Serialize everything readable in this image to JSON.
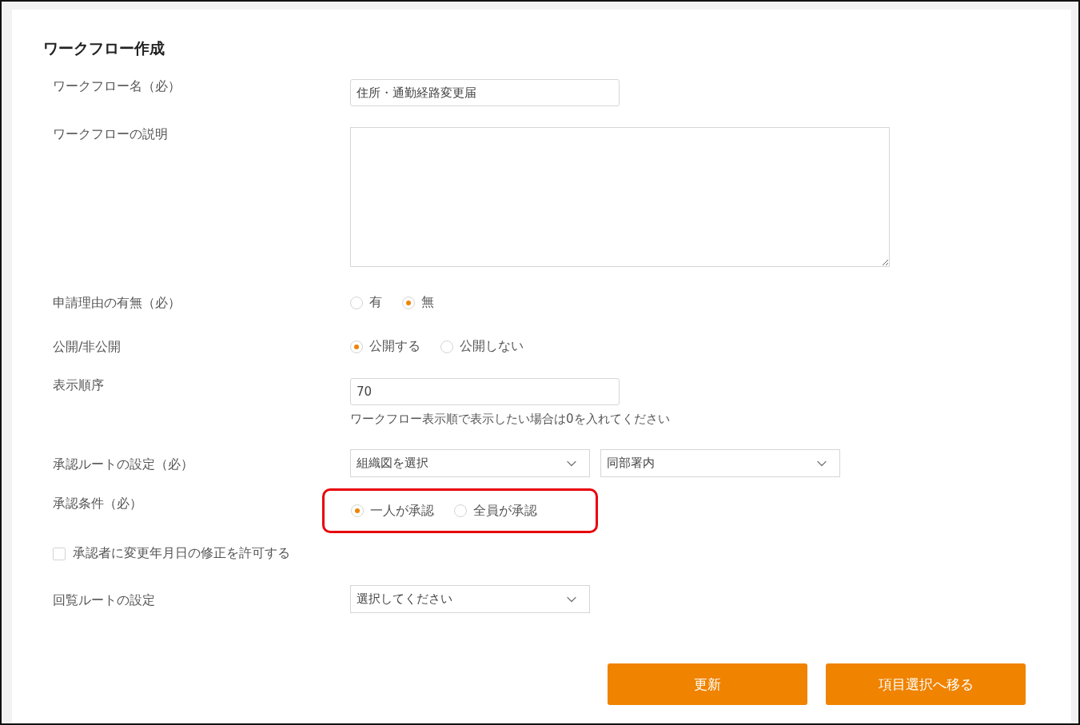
{
  "title": "ワークフロー作成",
  "fields": [
    {
      "kind": "text",
      "label": "ワークフロー名（必）",
      "value": "住所・通勤経路変更届"
    },
    {
      "kind": "textarea",
      "label": "ワークフローの説明"
    },
    {
      "kind": "radio",
      "label": "申請理由の有無（必）",
      "highlighted": false,
      "options": [
        {
          "label": "有",
          "selected": false
        },
        {
          "label": "無",
          "selected": true
        }
      ]
    },
    {
      "kind": "radio",
      "label": "公開/非公開",
      "highlighted": false,
      "options": [
        {
          "label": "公開する",
          "selected": true
        },
        {
          "label": "公開しない",
          "selected": false
        }
      ]
    },
    {
      "kind": "text",
      "label": "表示順序",
      "value": "70",
      "hint": "ワークフロー表示順で表示したい場合は0を入れてください"
    },
    {
      "kind": "selects",
      "label": "承認ルートの設定（必）",
      "selects": [
        "組織図を選択",
        "同部署内"
      ]
    },
    {
      "kind": "radio",
      "label": "承認条件（必）",
      "highlighted": true,
      "options": [
        {
          "label": "一人が承認",
          "selected": true
        },
        {
          "label": "全員が承認",
          "selected": false
        }
      ]
    },
    {
      "kind": "checkbox",
      "label": "承認者に変更年月日の修正を許可する",
      "checked": false
    },
    {
      "kind": "selects",
      "label": "回覧ルートの設定",
      "selects": [
        "選択してください"
      ]
    }
  ],
  "buttons": [
    "更新",
    "項目選択へ移る"
  ]
}
